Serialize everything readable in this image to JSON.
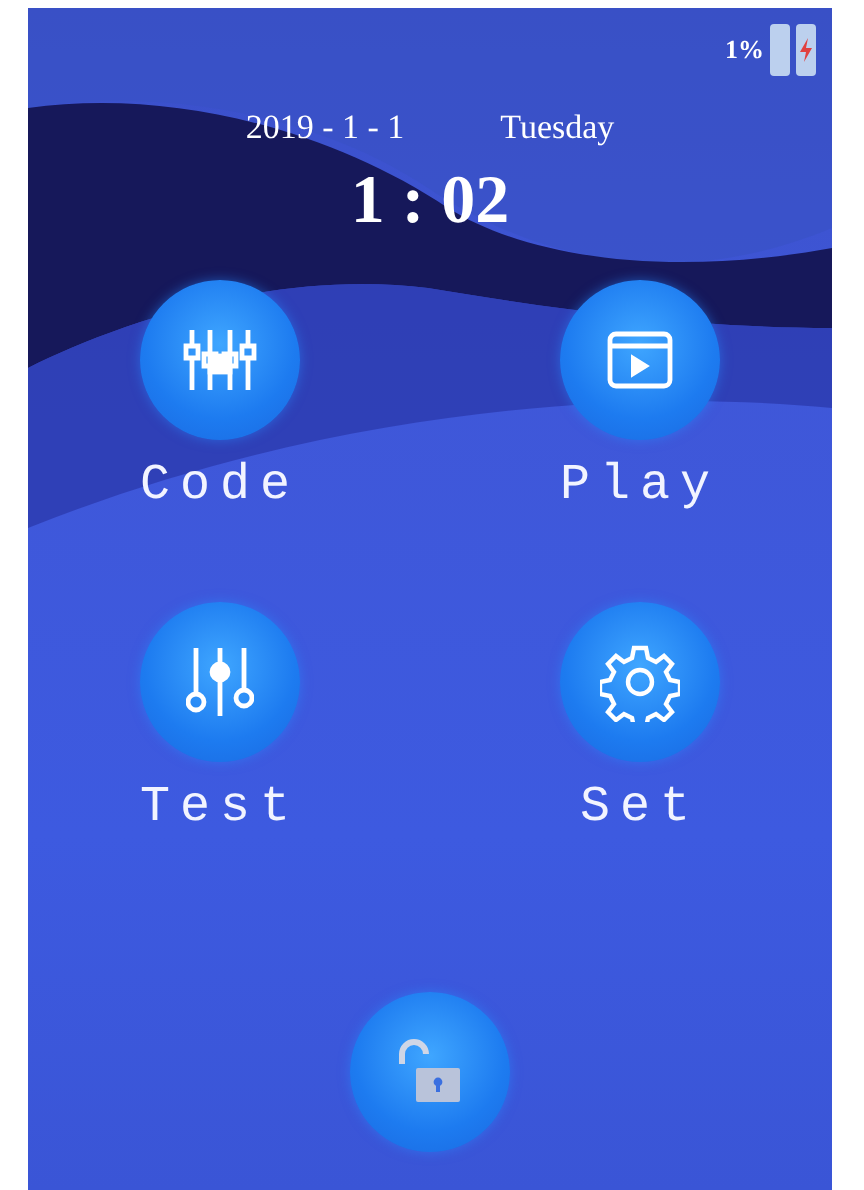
{
  "status_bar": {
    "battery_percent": "1%"
  },
  "date": "2019 - 1 - 1",
  "weekday": "Tuesday",
  "time": "1 : 02",
  "apps": [
    {
      "kind": "code",
      "label": "Code"
    },
    {
      "kind": "play",
      "label": "Play"
    },
    {
      "kind": "test",
      "label": "Test"
    },
    {
      "kind": "settings",
      "label": "Set"
    }
  ],
  "unlock_button": {
    "kind": "unlock"
  }
}
